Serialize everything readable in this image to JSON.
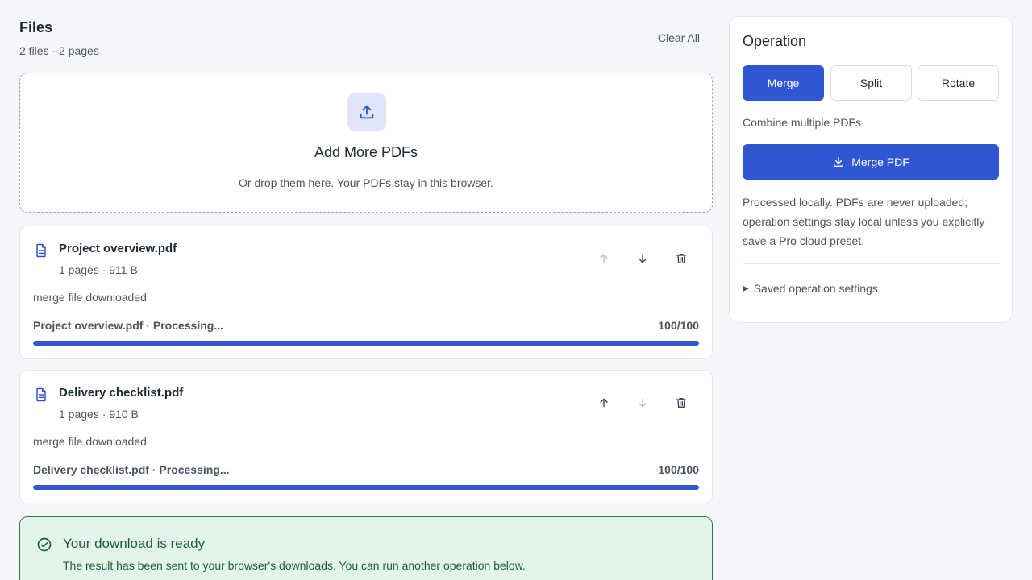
{
  "files_section": {
    "title": "Files",
    "subtitle": "2 files · 2 pages",
    "clear_all_label": "Clear All"
  },
  "dropzone": {
    "title": "Add More PDFs",
    "subtitle": "Or drop them here. Your PDFs stay in this browser."
  },
  "files": [
    {
      "name": "Project overview.pdf",
      "meta": "1 pages · 911 B",
      "status": "merge file downloaded",
      "progress_label": "Project overview.pdf · Processing...",
      "progress_count": "100/100",
      "progress_fraction": 1.0,
      "can_move_up": false,
      "can_move_down": true
    },
    {
      "name": "Delivery checklist.pdf",
      "meta": "1 pages · 910 B",
      "status": "merge file downloaded",
      "progress_label": "Delivery checklist.pdf · Processing...",
      "progress_count": "100/100",
      "progress_fraction": 1.0,
      "can_move_up": true,
      "can_move_down": false
    }
  ],
  "success_banner": {
    "title": "Your download is ready",
    "message": "The result has been sent to your browser's downloads. You can run another operation below."
  },
  "operation_panel": {
    "title": "Operation",
    "buttons": [
      {
        "label": "Merge",
        "active": true
      },
      {
        "label": "Split",
        "active": false
      },
      {
        "label": "Rotate",
        "active": false
      }
    ],
    "description": "Combine multiple PDFs",
    "run_label": "Merge PDF",
    "privacy_note": "Processed locally. PDFs are never uploaded; operation settings stay local unless you explicitly save a Pro cloud preset.",
    "saved_settings_label": "Saved operation settings"
  },
  "icons": {
    "upload": "upload-icon",
    "file": "document-icon",
    "up": "arrow-up-icon",
    "down": "arrow-down-icon",
    "delete": "trash-icon",
    "success": "check-circle-icon",
    "download": "download-icon"
  },
  "colors": {
    "accent": "#3056d3",
    "success_bg": "#e3f4ea",
    "success_text": "#1f5f36",
    "disabled_icon": "#b8bec8",
    "enabled_icon": "#374151"
  }
}
